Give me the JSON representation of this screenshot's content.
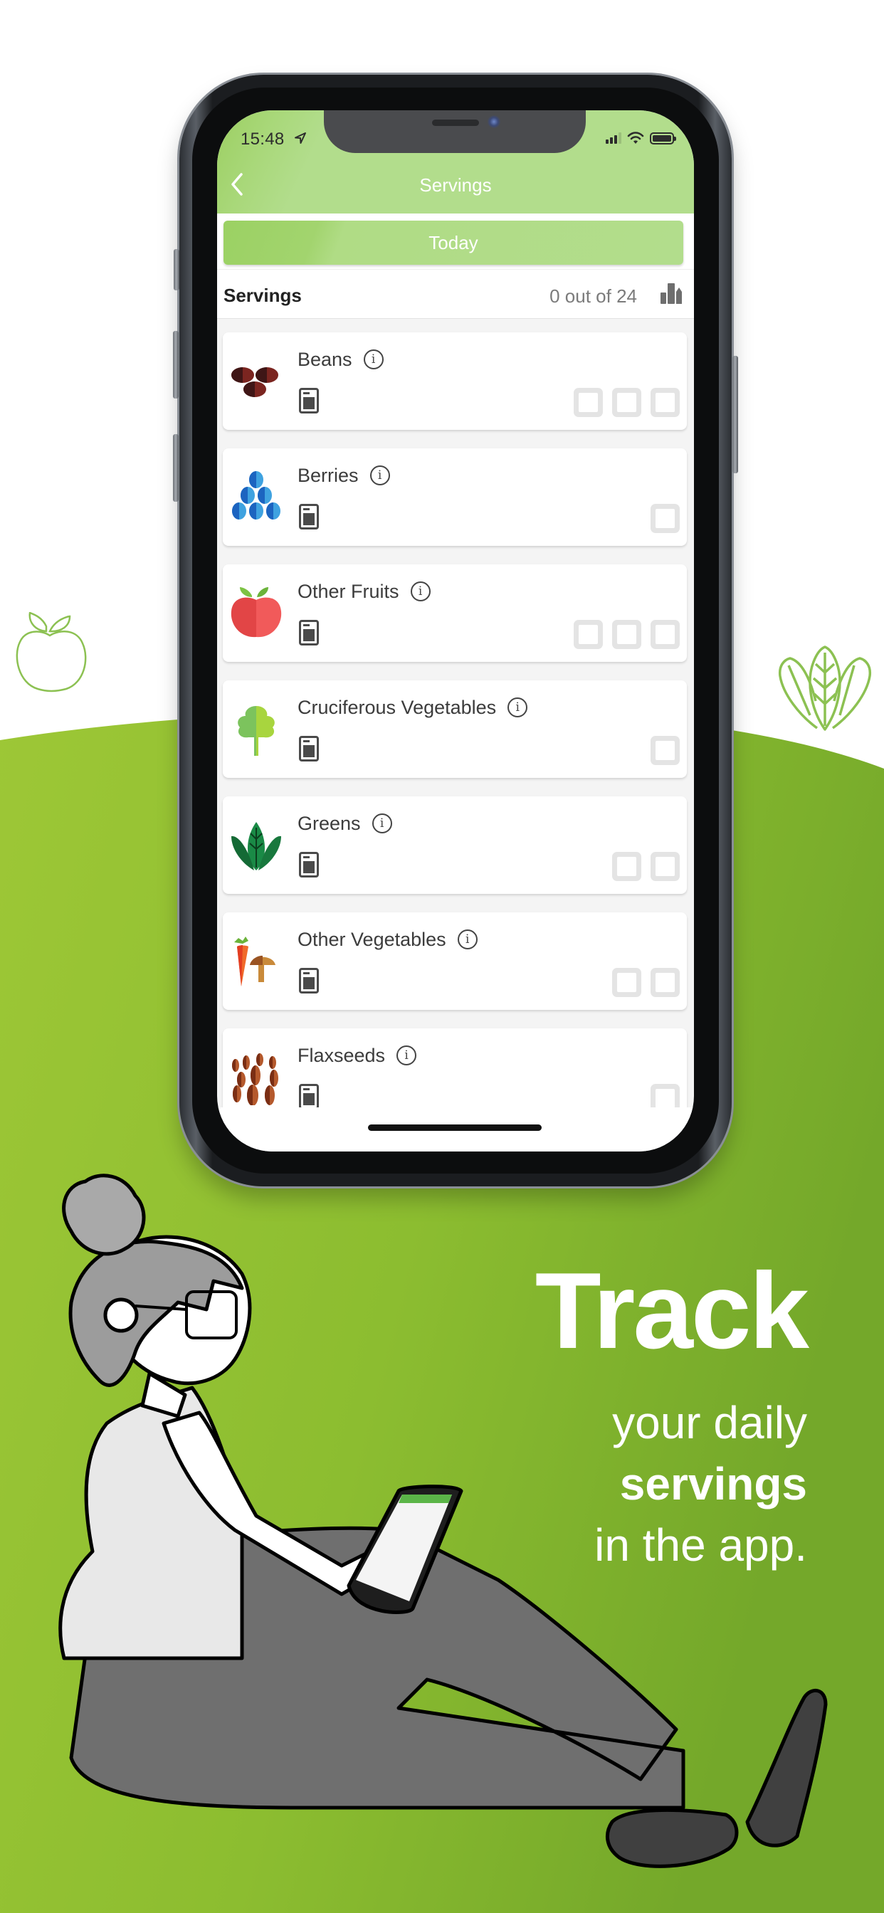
{
  "background": {
    "top_color": "#ffffff",
    "green_light": "#9bc734",
    "green_dark": "#77aa2a",
    "decorations": [
      "apple-outline-icon",
      "greens-outline-icon"
    ]
  },
  "device": {
    "status_bar": {
      "time": "15:48",
      "location_icon": "location-arrow-icon",
      "signal_icon": "cellular-signal-icon",
      "wifi_icon": "wifi-icon",
      "battery_icon": "battery-icon"
    },
    "nav": {
      "back_icon": "chevron-left-icon",
      "title": "Servings",
      "accent_color": "#b2dd8c"
    },
    "today_button": {
      "label": "Today"
    },
    "summary": {
      "label": "Servings",
      "count_text": "0 out of 24",
      "stats_icon": "bar-chart-icon"
    },
    "categories": [
      {
        "name": "Beans",
        "icon": "beans-icon",
        "boxes": 3,
        "checked": 0
      },
      {
        "name": "Berries",
        "icon": "berries-icon",
        "boxes": 1,
        "checked": 0
      },
      {
        "name": "Other Fruits",
        "icon": "apple-icon",
        "boxes": 3,
        "checked": 0
      },
      {
        "name": "Cruciferous Vegetables",
        "icon": "broccoli-icon",
        "boxes": 1,
        "checked": 0
      },
      {
        "name": "Greens",
        "icon": "leafy-greens-icon",
        "boxes": 2,
        "checked": 0
      },
      {
        "name": "Other Vegetables",
        "icon": "carrot-mushroom-icon",
        "boxes": 2,
        "checked": 0
      },
      {
        "name": "Flaxseeds",
        "icon": "flaxseeds-icon",
        "boxes": 1,
        "checked": 0
      }
    ],
    "info_glyph": "i"
  },
  "marketing": {
    "headline": "Track",
    "line1": "your daily",
    "line2": "servings",
    "line3": "in the app."
  }
}
